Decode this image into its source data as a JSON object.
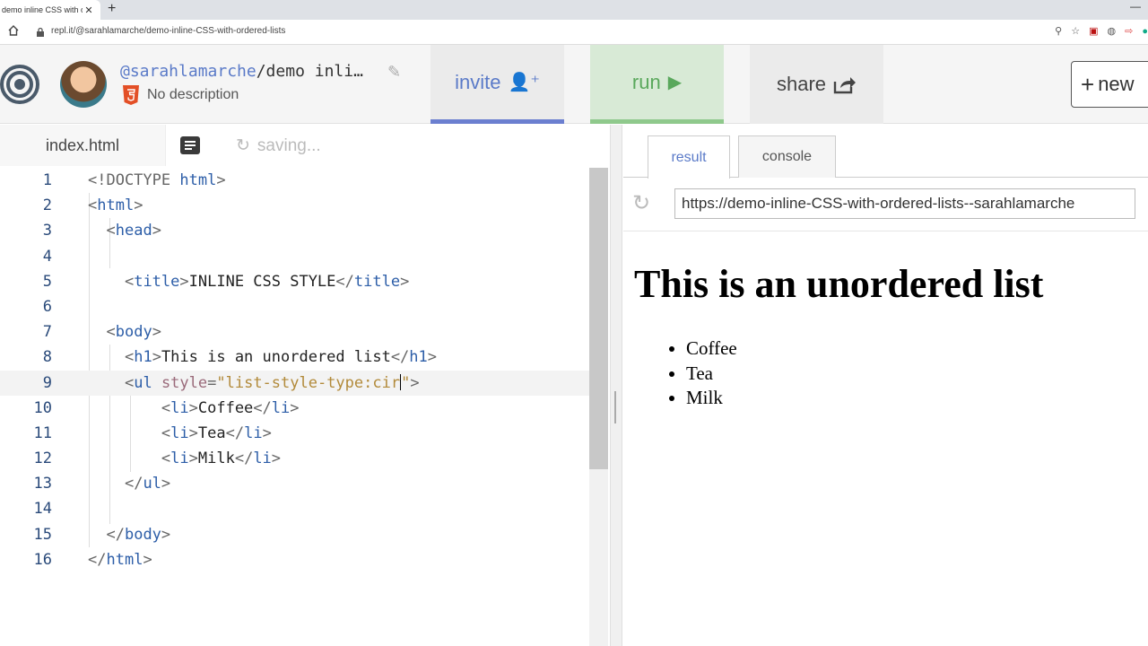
{
  "browser": {
    "tab_title": "demo inline CSS with ordered lists",
    "url": "repl.it/@sarahlamarche/demo-inline-CSS-with-ordered-lists"
  },
  "header": {
    "username": "@sarahlamarche",
    "repl_name": "/demo inli…",
    "description": "No description",
    "invite_label": "invite",
    "run_label": "run",
    "share_label": "share",
    "new_label": "new"
  },
  "editor": {
    "file_name": "index.html",
    "status": "saving...",
    "line_numbers": [
      "1",
      "2",
      "3",
      "4",
      "5",
      "6",
      "7",
      "8",
      "9",
      "10",
      "11",
      "12",
      "13",
      "14",
      "15",
      "16"
    ]
  },
  "result": {
    "tab_result": "result",
    "tab_console": "console",
    "url": "https://demo-inline-CSS-with-ordered-lists--sarahlamarche",
    "page_heading": "This is an unordered list",
    "list_items": [
      "Coffee",
      "Tea",
      "Milk"
    ]
  },
  "colors": {
    "accent_blue": "#5a7ac8",
    "run_green": "#5aa85c"
  }
}
